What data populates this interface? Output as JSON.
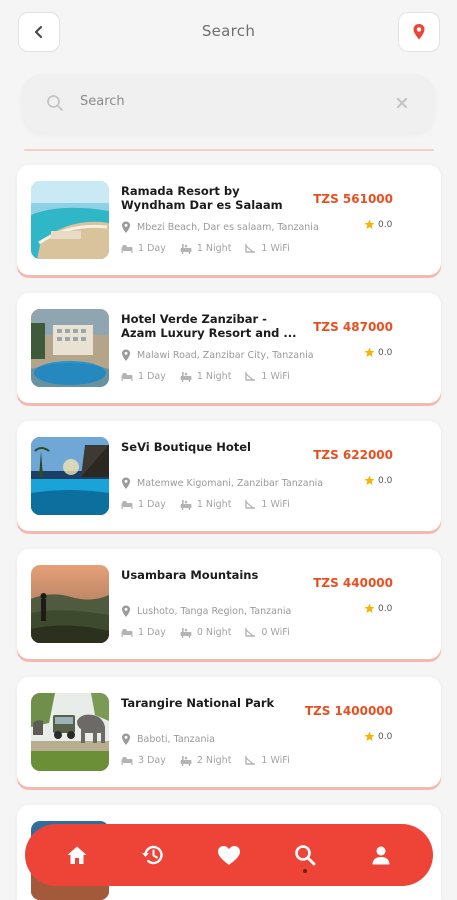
{
  "header": {
    "title": "Search"
  },
  "search": {
    "placeholder": "Search",
    "value": ""
  },
  "results": [
    {
      "name": "Ramada Resort by Wyndham Dar es Salaam",
      "price": "TZS 561000",
      "location": "Mbezi Beach, Dar es salaam, Tanzania",
      "rating": "0.0",
      "days": "1 Day",
      "nights": "1 Night",
      "wifi": "1 WiFi"
    },
    {
      "name": "Hotel Verde Zanzibar - Azam Luxury Resort and ...",
      "price": "TZS 487000",
      "location": "Malawi Road, Zanzibar City, Tanzania",
      "rating": "0.0",
      "days": "1 Day",
      "nights": "1 Night",
      "wifi": "1 WiFi"
    },
    {
      "name": "SeVi Boutique Hotel",
      "price": "TZS 622000",
      "location": "Matemwe Kigomani, Zanzibar Tanzania",
      "rating": "0.0",
      "days": "1 Day",
      "nights": "1 Night",
      "wifi": "1 WiFi"
    },
    {
      "name": "Usambara Mountains",
      "price": "TZS 440000",
      "location": "Lushoto, Tanga Region, Tanzania",
      "rating": "0.0",
      "days": "1 Day",
      "nights": "0 Night",
      "wifi": "0 WiFi"
    },
    {
      "name": "Tarangire National Park",
      "price": "TZS 1400000",
      "location": "Baboti, Tanzania",
      "rating": "0.0",
      "days": "3 Day",
      "nights": "2 Night",
      "wifi": "1 WiFi"
    }
  ],
  "colors": {
    "accent": "#ee4438",
    "price": "#e8501f",
    "star": "#f6b400"
  },
  "nav": [
    {
      "icon": "home-icon"
    },
    {
      "icon": "history-icon"
    },
    {
      "icon": "heart-icon"
    },
    {
      "icon": "search-icon",
      "active": true
    },
    {
      "icon": "profile-icon"
    }
  ]
}
